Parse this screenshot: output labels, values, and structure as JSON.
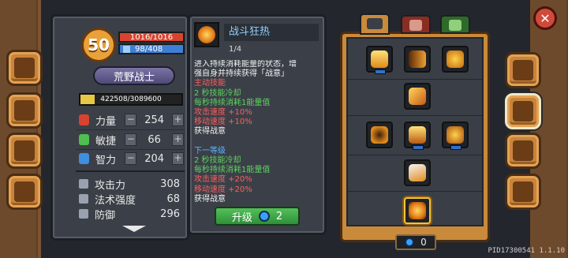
{
  "hero": {
    "level": "50",
    "hp": "1016/1016",
    "mp": "98/408",
    "class_name": "荒野战士",
    "exp": "422508/3089600",
    "exp_fraction": 0.137
  },
  "attributes": [
    {
      "name": "力量",
      "value": "254",
      "icon": "strength-fist-icon",
      "color": "#d8432f"
    },
    {
      "name": "敏捷",
      "value": "66",
      "icon": "agility-feather-icon",
      "color": "#4fbf4f"
    },
    {
      "name": "智力",
      "value": "204",
      "icon": "intelligence-book-icon",
      "color": "#3f8fe0"
    }
  ],
  "stats": [
    {
      "name": "攻击力",
      "value": "308",
      "icon": "sword-icon"
    },
    {
      "name": "法术强度",
      "value": "68",
      "icon": "wand-icon"
    },
    {
      "name": "防御",
      "value": "296",
      "icon": "shield-icon"
    }
  ],
  "skill": {
    "name": "战斗狂热",
    "rank": "1/4",
    "lines": [
      {
        "text": "进入持续消耗能量的状态，增",
        "color": "w"
      },
      {
        "text": "强自身并持续获得「战意」",
        "color": "w"
      },
      {
        "text": "主动技能",
        "color": "r"
      },
      {
        "text": "2 秒技能冷却",
        "color": "g"
      },
      {
        "text": "每秒持续消耗1能量值",
        "color": "g"
      },
      {
        "text": "攻击速度 +10%",
        "color": "r"
      },
      {
        "text": "移动速度 +10%",
        "color": "r"
      },
      {
        "text": "获得战意",
        "color": "w"
      },
      {
        "text": "",
        "color": "w"
      },
      {
        "text": "下一等级",
        "color": "b"
      },
      {
        "text": "2 秒技能冷却",
        "color": "g"
      },
      {
        "text": "每秒持续消耗1能量值",
        "color": "g"
      },
      {
        "text": "攻击速度 +20%",
        "color": "r"
      },
      {
        "text": "移动速度 +20%",
        "color": "r"
      },
      {
        "text": "获得战意",
        "color": "w"
      }
    ],
    "upgrade_label": "升级",
    "upgrade_cost": "2"
  },
  "skill_points": "0",
  "pid": "PID17300541 1.1.10",
  "close_label": "✕"
}
